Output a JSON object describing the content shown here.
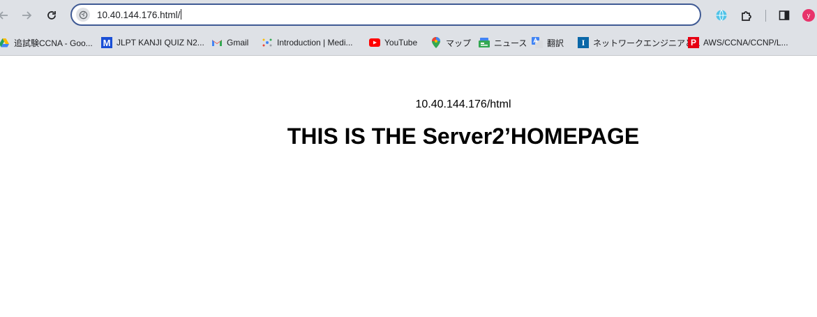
{
  "browser": {
    "url": "10.40.144.176.html/"
  },
  "bookmarks": [
    {
      "label": "追試験CCNA - Goo...",
      "icon": "google-drive-icon"
    },
    {
      "label": "JLPT KANJI QUIZ N2...",
      "icon": "m-logo-icon"
    },
    {
      "label": "Gmail",
      "icon": "gmail-icon"
    },
    {
      "label": "Introduction | Medi...",
      "icon": "mediapipe-icon"
    },
    {
      "label": "YouTube",
      "icon": "youtube-icon"
    },
    {
      "label": "マップ",
      "icon": "maps-icon"
    },
    {
      "label": "ニュース",
      "icon": "news-icon"
    },
    {
      "label": "翻訳",
      "icon": "translate-icon"
    },
    {
      "label": "ネットワークエンジニアと...",
      "icon": "i-logo-icon"
    },
    {
      "label": "AWS/CCNA/CCNP/L...",
      "icon": "p-logo-icon"
    }
  ],
  "page": {
    "subheading": "10.40.144.176/html",
    "heading": "THIS IS THE Server2’HOMEPAGE"
  },
  "profile": {
    "initial": "y"
  },
  "colors": {
    "toolbar_bg": "#dee1e6",
    "omnibox_border": "#3f5a94",
    "profile_bg": "#e8336b"
  }
}
